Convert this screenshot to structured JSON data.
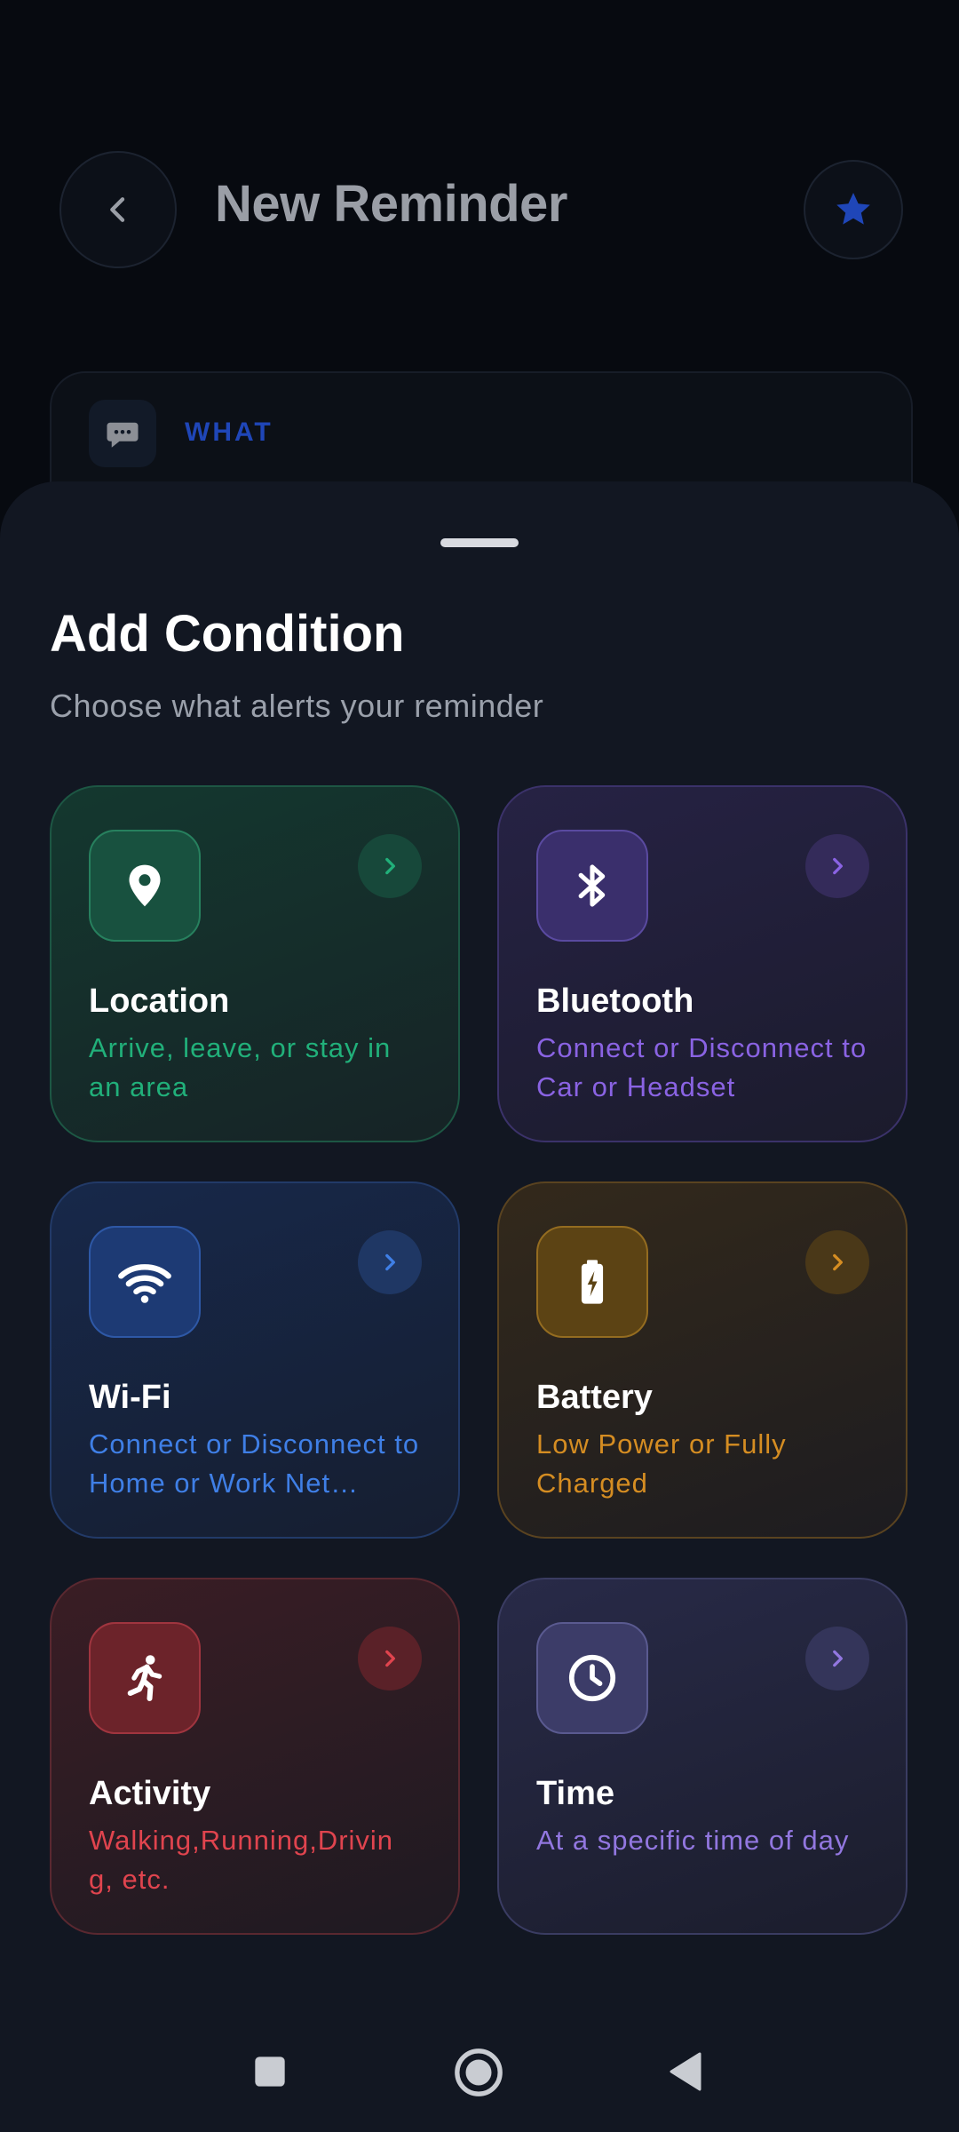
{
  "header": {
    "title": "New Reminder"
  },
  "what_section": {
    "label": "WHAT"
  },
  "sheet": {
    "title": "Add Condition",
    "subtitle": "Choose what alerts your reminder"
  },
  "conditions": [
    {
      "title": "Location",
      "description": "Arrive, leave, or stay in an area",
      "icon": "map-pin-icon",
      "accent": "#21b07a"
    },
    {
      "title": "Bluetooth",
      "description": "Connect or Disconnect to Car or Headset",
      "icon": "bluetooth-icon",
      "accent": "#8a63e3"
    },
    {
      "title": "Wi-Fi",
      "description": "Connect or Disconnect to Home or Work Net…",
      "icon": "wifi-icon",
      "accent": "#3f7fe6"
    },
    {
      "title": "Battery",
      "description": "Low Power or Fully Charged",
      "icon": "battery-icon",
      "accent": "#d58d22"
    },
    {
      "title": "Activity",
      "description": "Walking,Running,Drivin g, etc.",
      "icon": "running-person-icon",
      "accent": "#e0444e"
    },
    {
      "title": "Time",
      "description": "At a specific time of day",
      "icon": "clock-icon",
      "accent": "#9277e0"
    }
  ],
  "colors": {
    "background": "#0a0d14",
    "sheet": "#121722",
    "star_accent": "#1f46b8"
  }
}
